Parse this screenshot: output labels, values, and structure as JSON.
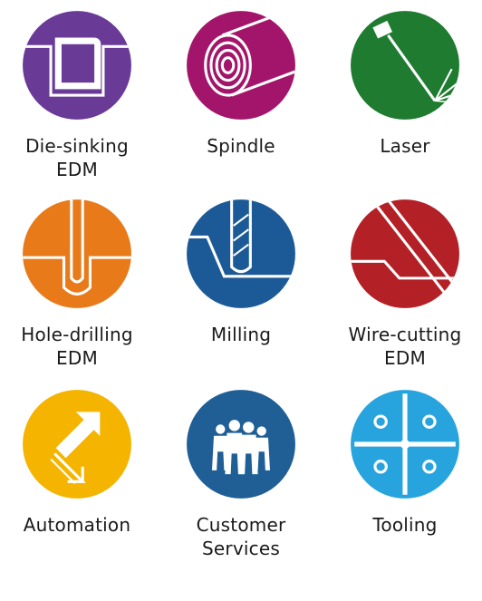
{
  "services": [
    {
      "line1": "Die-sinking",
      "line2": "EDM",
      "color": "#6a3a97",
      "icon": "die-sinking-edm-icon"
    },
    {
      "line1": "Spindle",
      "line2": "",
      "color": "#a3156a",
      "icon": "spindle-icon"
    },
    {
      "line1": "Laser",
      "line2": "",
      "color": "#1e7b2f",
      "icon": "laser-icon"
    },
    {
      "line1": "Hole-drilling",
      "line2": "EDM",
      "color": "#e87a1a",
      "icon": "hole-drilling-edm-icon"
    },
    {
      "line1": "Milling",
      "line2": "",
      "color": "#1c5a97",
      "icon": "milling-icon"
    },
    {
      "line1": "Wire-cutting",
      "line2": "EDM",
      "color": "#b32026",
      "icon": "wire-cutting-edm-icon"
    },
    {
      "line1": "Automation",
      "line2": "",
      "color": "#f4b400",
      "icon": "automation-icon"
    },
    {
      "line1": "Customer",
      "line2": "Services",
      "color": "#1f5f96",
      "icon": "customer-services-icon"
    },
    {
      "line1": "Tooling",
      "line2": "",
      "color": "#27a4de",
      "icon": "tooling-icon"
    }
  ]
}
